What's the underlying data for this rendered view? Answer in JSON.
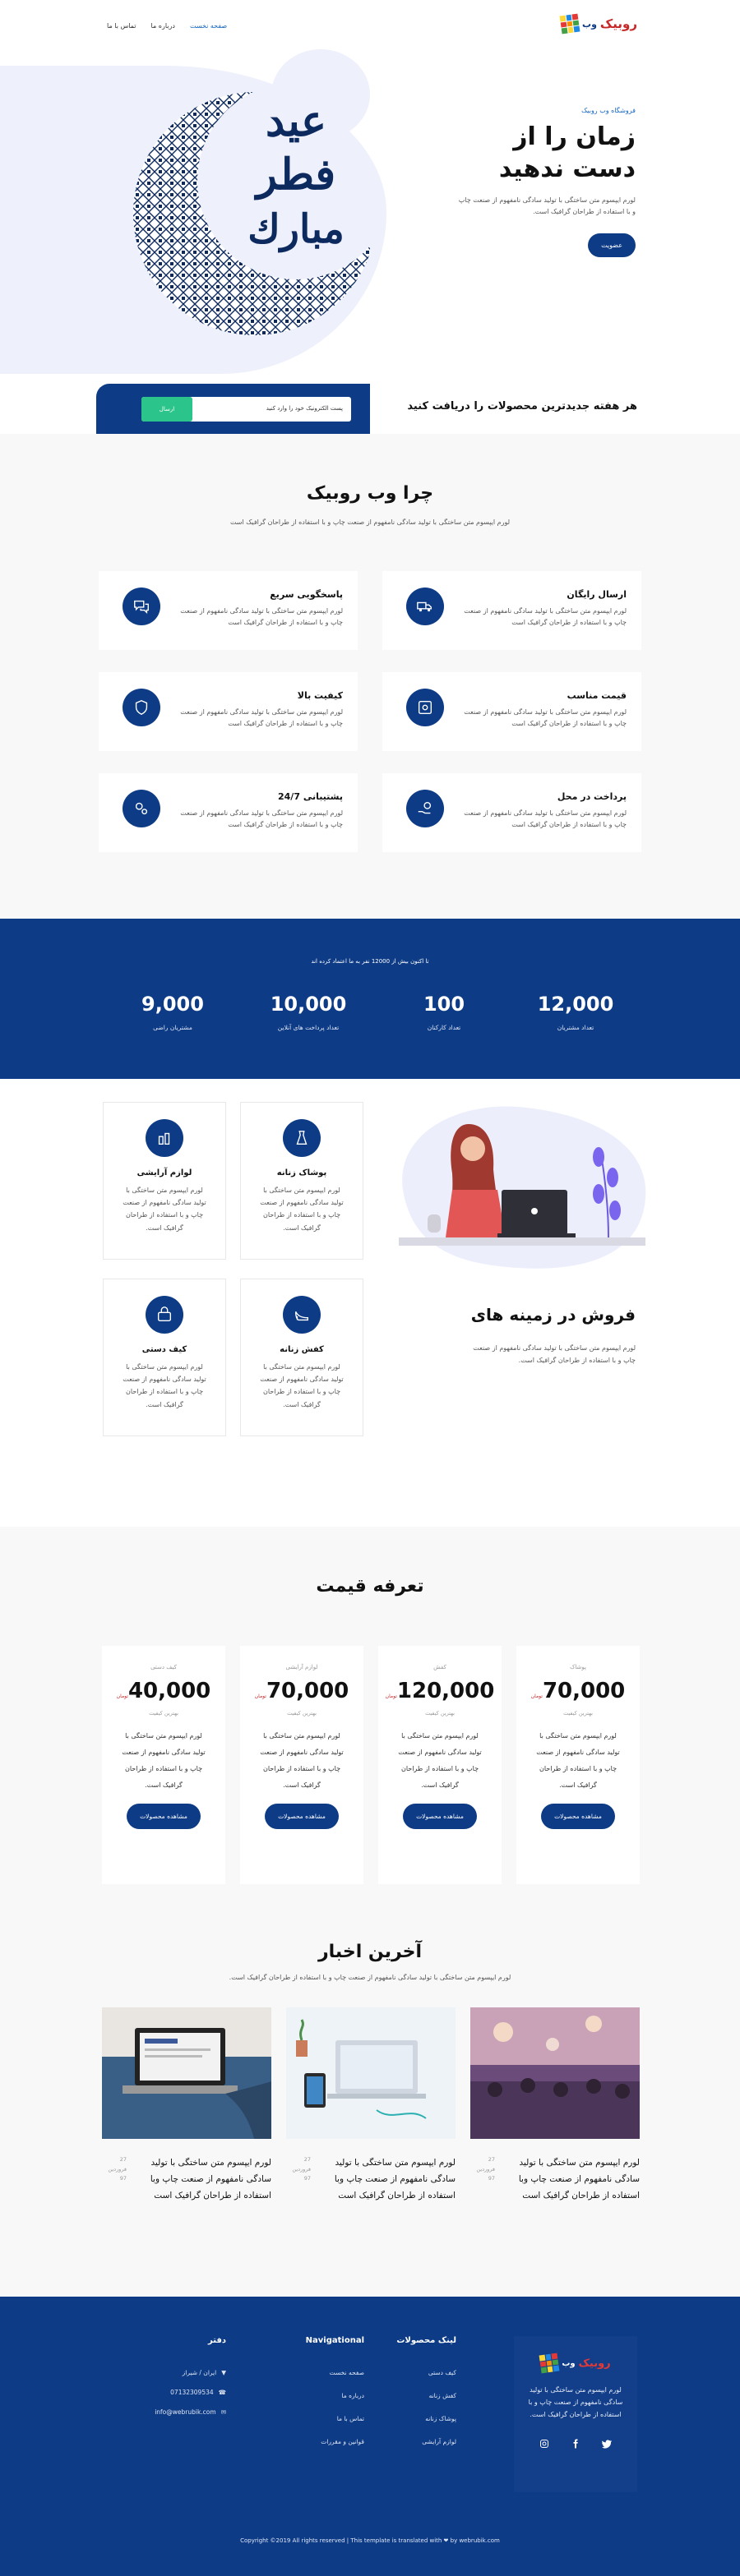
{
  "nav": {
    "logo_text": "روبیک",
    "logo_sub": "وب",
    "menu": [
      "صفحه نخست",
      "درباره ما",
      "تماس با ما"
    ]
  },
  "hero": {
    "eyebrow": "فروشگاه وب روبیک",
    "title": "زمان را از دست ندهید",
    "desc": "لورم ایپسوم متن ساختگی با تولید سادگی نامفهوم از صنعت چاپ و با استفاده از طراحان گرافیک است.",
    "button": "عضویت",
    "art_text": [
      "عید",
      "فطر",
      "مبارك"
    ]
  },
  "newsletter": {
    "title": "هر هفته جدیدترین محصولات را دریافت کنید",
    "placeholder": "پست الکترونیک خود را وارد کنید",
    "button": "ارسال"
  },
  "why": {
    "title": "چرا وب روبیک",
    "subtitle": "لورم ایپسوم متن ساختگی با تولید سادگی نامفهوم از صنعت چاپ و با استفاده از طراحان گرافیک است",
    "features": [
      {
        "title": "ارسال رایگان",
        "desc": "لورم ایپسوم متن ساختگی با تولید سادگی نامفهوم از صنعت چاپ و با استفاده از طراحان گرافیک است",
        "icon": "truck-icon"
      },
      {
        "title": "پاسخگویی سریع",
        "desc": "لورم ایپسوم متن ساختگی با تولید سادگی نامفهوم از صنعت چاپ و با استفاده از طراحان گرافیک است",
        "icon": "chat-icon"
      },
      {
        "title": "قیمت مناسب",
        "desc": "لورم ایپسوم متن ساختگی با تولید سادگی نامفهوم از صنعت چاپ و با استفاده از طراحان گرافیک است",
        "icon": "money-icon"
      },
      {
        "title": "کیفیت بالا",
        "desc": "لورم ایپسوم متن ساختگی با تولید سادگی نامفهوم از صنعت چاپ و با استفاده از طراحان گرافیک است",
        "icon": "shield-icon"
      },
      {
        "title": "پرداخت در محل",
        "desc": "لورم ایپسوم متن ساختگی با تولید سادگی نامفهوم از صنعت چاپ و با استفاده از طراحان گرافیک است",
        "icon": "hand-coin-icon"
      },
      {
        "title": "پشتیبانی 24/7",
        "desc": "لورم ایپسوم متن ساختگی با تولید سادگی نامفهوم از صنعت چاپ و با استفاده از طراحان گرافیک است",
        "icon": "gears-icon"
      }
    ]
  },
  "stats": {
    "heading": "تا اکنون بیش از 12000 نفر به ما اعتماد کرده اند",
    "items": [
      {
        "num": "12,000",
        "label": "تعداد مشتریان"
      },
      {
        "num": "100",
        "label": "تعداد کارکنان"
      },
      {
        "num": "10,000",
        "label": "تعداد پرداخت های آنلاین"
      },
      {
        "num": "9,000",
        "label": "مشتریان راضی"
      }
    ]
  },
  "categories": {
    "title": "فروش در زمینه های",
    "desc": "لورم ایپسوم متن ساختگی با تولید سادگی نامفهوم از صنعت چاپ و با استفاده از طراحان گرافیک است.",
    "items": [
      {
        "title": "پوشاک زنانه",
        "desc": "لورم ایپسوم متن ساختگی با تولید سادگی نامفهوم از صنعت چاپ و با استفاده از طراحان گرافیک است.",
        "icon": "dress-icon"
      },
      {
        "title": "لوازم آرایشی",
        "desc": "لورم ایپسوم متن ساختگی با تولید سادگی نامفهوم از صنعت چاپ و با استفاده از طراحان گرافیک است.",
        "icon": "cosmetics-icon"
      },
      {
        "title": "کفش زنانه",
        "desc": "لورم ایپسوم متن ساختگی با تولید سادگی نامفهوم از صنعت چاپ و با استفاده از طراحان گرافیک است.",
        "icon": "heel-icon"
      },
      {
        "title": "کیف دستی",
        "desc": "لورم ایپسوم متن ساختگی با تولید سادگی نامفهوم از صنعت چاپ و با استفاده از طراحان گرافیک است.",
        "icon": "handbag-icon"
      }
    ]
  },
  "pricing": {
    "title": "تعرفه قیمت",
    "items": [
      {
        "cat": "پوشاک",
        "amount": "70,000",
        "currency": "تومان",
        "note": "بهترین کیفیت",
        "desc": "لورم ایپسوم متن ساختگی با تولید سادگی نامفهوم از صنعت چاپ و با استفاده از طراحان گرافیک است.",
        "button": "مشاهده محصولات"
      },
      {
        "cat": "کفش",
        "amount": "120,000",
        "currency": "تومان",
        "note": "بهترین کیفیت",
        "desc": "لورم ایپسوم متن ساختگی با تولید سادگی نامفهوم از صنعت چاپ و با استفاده از طراحان گرافیک است.",
        "button": "مشاهده محصولات"
      },
      {
        "cat": "لوازم آرایشی",
        "amount": "70,000",
        "currency": "تومان",
        "note": "بهترین کیفیت",
        "desc": "لورم ایپسوم متن ساختگی با تولید سادگی نامفهوم از صنعت چاپ و با استفاده از طراحان گرافیک است.",
        "button": "مشاهده محصولات"
      },
      {
        "cat": "کیف دستی",
        "amount": "40,000",
        "currency": "تومان",
        "note": "بهترین کیفیت",
        "desc": "لورم ایپسوم متن ساختگی با تولید سادگی نامفهوم از صنعت چاپ و با استفاده از طراحان گرافیک است.",
        "button": "مشاهده محصولات"
      }
    ]
  },
  "posts": {
    "title": "آخرین اخبار",
    "subtitle": "لورم ایپسوم متن ساختگی با تولید سادگی نامفهوم از صنعت چاپ و با استفاده از طراحان گرافیک است.",
    "items": [
      {
        "date": "27 فروردین 97",
        "title": "لورم ایپسوم متن ساختگی با تولید سادگی نامفهوم از صنعت چاپ وبا استفاده از طراحان گرافیک است"
      },
      {
        "date": "27 فروردین 97",
        "title": "لورم ایپسوم متن ساختگی با تولید سادگی نامفهوم از صنعت چاپ وبا استفاده از طراحان گرافیک است"
      },
      {
        "date": "27 فروردین 97",
        "title": "لورم ایپسوم متن ساختگی با تولید سادگی نامفهوم از صنعت چاپ وبا استفاده از طراحان گرافیک است"
      }
    ]
  },
  "footer": {
    "brand_desc": "لورم ایپسوم متن ساختگی با تولید سادگی نامفهوم از صنعت چاپ و با استفاده از طراحان گرافیک است.",
    "col_products": {
      "title": "لینک محصولات",
      "links": [
        "کیف دستی",
        "کفش زنانه",
        "پوشاک زنانه",
        "لوازم آرایشی"
      ]
    },
    "col_nav": {
      "title": "Navigational",
      "links": [
        "صفحه نخست",
        "درباره ما",
        "تماس با ما",
        "قوانین و مقررات"
      ]
    },
    "col_office": {
      "title": "دفتر",
      "address": "ایران / شیراز",
      "phone": "07132309534",
      "email": "info@webrubik.com"
    },
    "copyright": "Copyright ©2019 All rights reserved | This template is translated with ❤ by webrubik.com"
  }
}
